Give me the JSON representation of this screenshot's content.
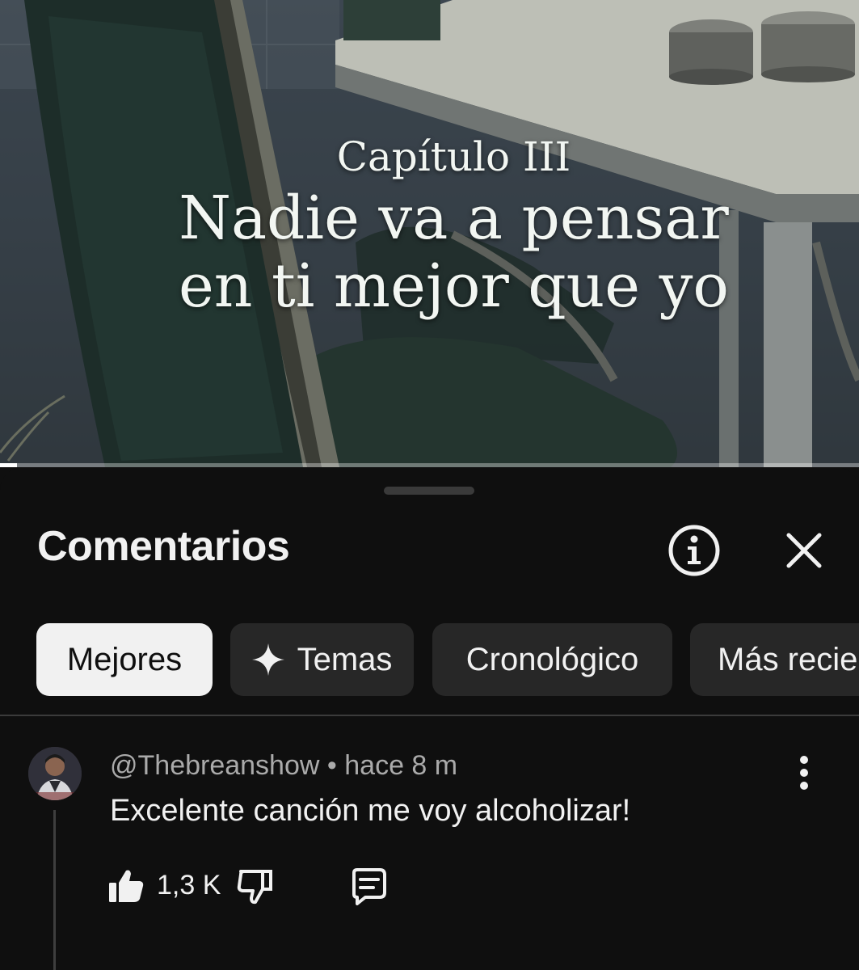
{
  "video": {
    "chapter": "Capítulo III",
    "title_line1": "Nadie va a pensar",
    "title_line2": "en ti mejor que yo",
    "progress": 0.02
  },
  "comments_panel": {
    "title": "Comentarios",
    "info_icon": "info-icon",
    "close_icon": "close-icon",
    "filters": [
      {
        "label": "Mejores",
        "active": true
      },
      {
        "label": "Temas",
        "icon": "sparkle-icon",
        "active": false
      },
      {
        "label": "Cronológico",
        "active": false
      },
      {
        "label": "Más recie",
        "active": false
      }
    ],
    "comment": {
      "author": "@Thebreanshow",
      "separator": "•",
      "time": "hace 8 m",
      "text": "Excelente canción me voy alcoholizar!",
      "likes": "1,3 K",
      "icons": [
        "thumb-up-icon",
        "thumb-down-icon",
        "reply-icon",
        "more-vert-icon"
      ]
    }
  },
  "colors": {
    "background": "#0f0f0f",
    "chip": "#272727",
    "chip_active": "#f1f1f1",
    "secondary_text": "#aaaaaa"
  }
}
